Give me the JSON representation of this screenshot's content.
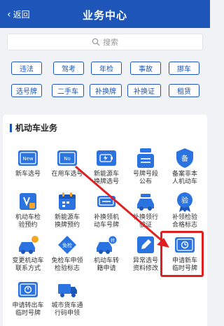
{
  "header": {
    "back_label": "返回",
    "title": "业务中心"
  },
  "search": {
    "placeholder": "搜索"
  },
  "tags": [
    "违法",
    "驾考",
    "年检",
    "事故",
    "挪车",
    "选号牌",
    "二手车",
    "补换牌",
    "补换证",
    "租赁"
  ],
  "section": {
    "title": "机动车业务"
  },
  "grid": [
    {
      "label": "新车选号",
      "icon": "new-car-plate-icon"
    },
    {
      "label": "在用车选号",
      "icon": "used-car-plate-icon"
    },
    {
      "label": "新能源车\n换牌选号",
      "icon": "new-energy-plate-icon"
    },
    {
      "label": "号牌号段\n公布",
      "icon": "plate-range-icon"
    },
    {
      "label": "备案非本\n人机动车",
      "icon": "record-icon"
    },
    {
      "label": "机动车检\n验预约",
      "icon": "inspection-appointment-icon"
    },
    {
      "label": "新能源车\n换牌预约",
      "icon": "calendar-icon"
    },
    {
      "label": "补换领机\n动车号牌",
      "icon": "replace-plate-icon"
    },
    {
      "label": "补换领行\n驶证",
      "icon": "replace-license-icon"
    },
    {
      "label": "补领检验\n合格标志",
      "icon": "inspection-mark-icon"
    },
    {
      "label": "变更机动车\n联系方式",
      "icon": "change-contact-icon"
    },
    {
      "label": "免检车申领\n检验标志",
      "icon": "exempt-icon"
    },
    {
      "label": "机动车转\n籍申请",
      "icon": "transfer-icon"
    },
    {
      "label": "异常选号\n资料修改",
      "icon": "edit-icon"
    },
    {
      "label": "申请新车\n临时号牌",
      "icon": "temporary-plate-icon"
    },
    {
      "label": "申请转出车\n临时号牌",
      "icon": "transfer-temp-plate-icon"
    },
    {
      "label": "城市货车通\n行码申领",
      "icon": "truck-icon"
    }
  ],
  "colors": {
    "primary": "#1d56b8",
    "icon_blue": "#2a73e0",
    "highlight": "#e02020"
  }
}
